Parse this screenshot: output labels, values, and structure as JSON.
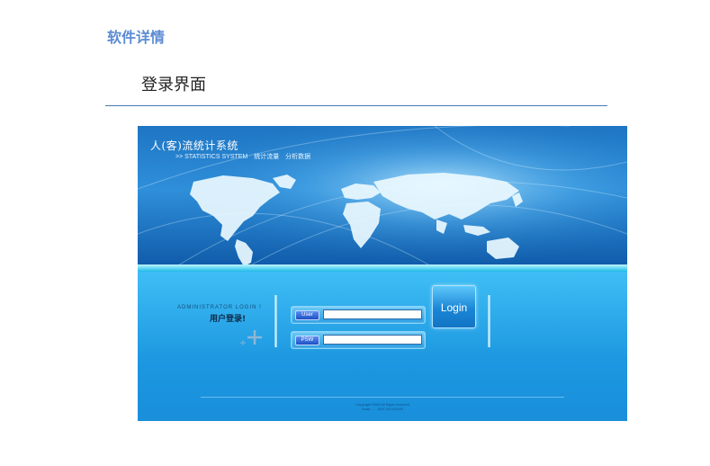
{
  "doc": {
    "section_title": "软件详情",
    "subtitle": "登录界面"
  },
  "login_screen": {
    "title": "人(客)流统计系统",
    "subtitle_en": ">> STATISTICS SYSTEM",
    "subtitle_cn1": "统计流量",
    "subtitle_cn2": "分析数据",
    "admin_en": "ADMINISTRATOR LOGIN !",
    "admin_cn": "用户登录!",
    "user_tag": "User",
    "user_value": "",
    "psw_tag": "PSW",
    "psw_value": "",
    "login_button": "Login",
    "copyright_line1": "Copyright 2009 All Right reserved",
    "copyright_line2": "Email: ... · JENT, 000-000000"
  },
  "colors": {
    "heading": "#5b8bd3",
    "rule": "#4a78b8",
    "panel_blue": "#22a0e6"
  }
}
